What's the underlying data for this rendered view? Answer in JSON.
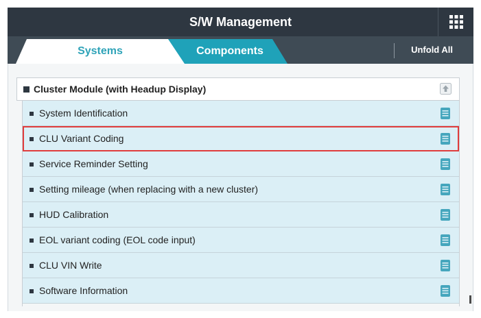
{
  "header": {
    "title": "S/W Management",
    "menu_icon": "grid-icon"
  },
  "tabs": [
    {
      "label": "Systems",
      "active": true
    },
    {
      "label": "Components",
      "active": false
    }
  ],
  "unfold_all_label": "Unfold All",
  "group": {
    "label": "Cluster Module (with Headup Display)",
    "collapse_icon": "collapse-up-icon",
    "items": [
      {
        "label": "System Identification",
        "icon": "document-icon"
      },
      {
        "label": "CLU Variant Coding",
        "icon": "document-icon",
        "highlighted": true
      },
      {
        "label": "Service Reminder Setting",
        "icon": "document-icon"
      },
      {
        "label": "Setting mileage (when replacing with a new cluster)",
        "icon": "document-icon"
      },
      {
        "label": "HUD Calibration",
        "icon": "document-icon"
      },
      {
        "label": "EOL variant coding (EOL code input)",
        "icon": "document-icon"
      },
      {
        "label": "CLU VIN Write",
        "icon": "document-icon"
      },
      {
        "label": "Software Information",
        "icon": "document-icon"
      }
    ]
  },
  "colors": {
    "titlebar": "#2e3741",
    "tabbar": "#3f4b55",
    "accent": "#1fa2b9",
    "item_background": "#dbeff6",
    "highlight_border": "#e03c3c",
    "doc_icon": "#45a6bd"
  }
}
